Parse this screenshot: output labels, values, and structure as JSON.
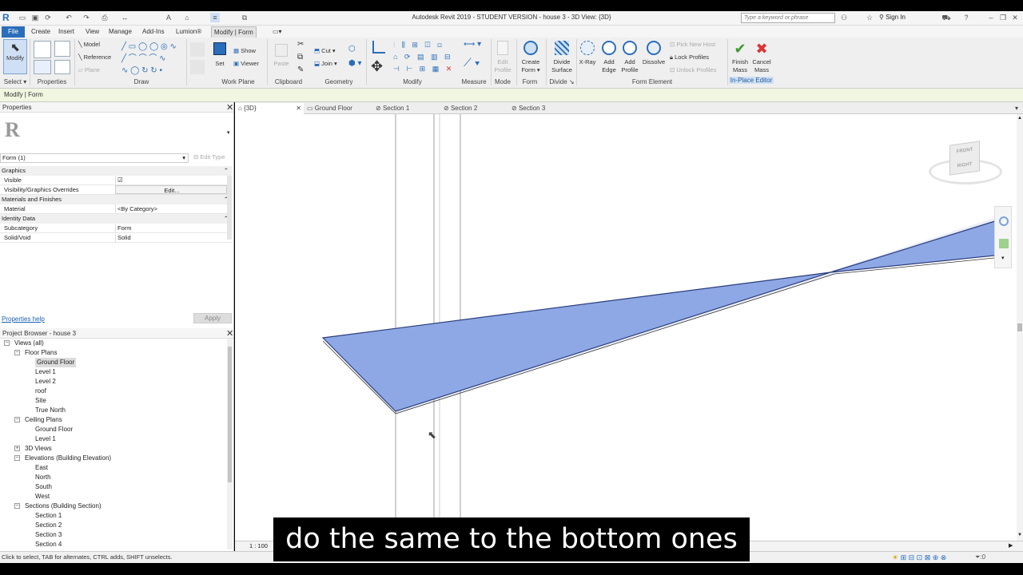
{
  "window": {
    "title": "Autodesk Revit 2019 - STUDENT VERSION - house 3 - 3D View: {3D}",
    "search_placeholder": "Type a keyword or phrase",
    "sign_in": "Sign In"
  },
  "ribbon_tabs": [
    "File",
    "Create",
    "Insert",
    "View",
    "Manage",
    "Add-Ins",
    "Lumion®",
    "Modify | Form"
  ],
  "ribbon": {
    "select": {
      "modify": "Modify",
      "label": "Select ▾"
    },
    "properties_label": "Properties",
    "draw": {
      "model": "Model",
      "reference": "Reference",
      "plane": "Plane",
      "label": "Draw"
    },
    "work_plane": {
      "set": "Set",
      "show": "Show",
      "viewer": "Viewer",
      "label": "Work Plane"
    },
    "clipboard": {
      "paste": "Paste",
      "cut": "Cut",
      "join": "Join",
      "label": "Clipboard"
    },
    "geometry_label": "Geometry",
    "modify_label": "Modify",
    "measure_label": "Measure",
    "mode": {
      "edit_profile_1": "Edit",
      "edit_profile_2": "Profile",
      "label": "Mode"
    },
    "form": {
      "create_1": "Create",
      "create_2": "Form",
      "label": "Form"
    },
    "divide": {
      "surface_1": "Divide",
      "surface_2": "Surface",
      "label": "Divide"
    },
    "form_element": {
      "xray": "X-Ray",
      "add_edge_1": "Add",
      "add_edge_2": "Edge",
      "add_profile_1": "Add",
      "add_profile_2": "Profile",
      "dissolve": "Dissolve",
      "pick_new_host": "Pick New Host",
      "lock_profiles": "Lock Profiles",
      "unlock_profiles": "Unlock Profiles",
      "label": "Form Element"
    },
    "in_place": {
      "finish_1": "Finish",
      "finish_2": "Mass",
      "cancel_1": "Cancel",
      "cancel_2": "Mass",
      "label": "In-Place Editor"
    }
  },
  "context_bar": "Modify | Form",
  "properties": {
    "header": "Properties",
    "type_selector": "Form (1)",
    "edit_type": "Edit Type",
    "groups": [
      {
        "name": "Graphics",
        "rows": [
          {
            "key": "Visible",
            "value": "☑"
          },
          {
            "key": "Visibility/Graphics Overrides",
            "value": "Edit..."
          }
        ]
      },
      {
        "name": "Materials and Finishes",
        "rows": [
          {
            "key": "Material",
            "value": "<By Category>"
          }
        ]
      },
      {
        "name": "Identity Data",
        "rows": [
          {
            "key": "Subcategory",
            "value": "Form"
          },
          {
            "key": "Solid/Void",
            "value": "Solid"
          }
        ]
      }
    ],
    "help_link": "Properties help",
    "apply": "Apply"
  },
  "project_browser": {
    "header": "Project Browser - house 3",
    "items": [
      {
        "label": "Views (all)",
        "level": 0,
        "twisty": "−"
      },
      {
        "label": "Floor Plans",
        "level": 1,
        "twisty": "−"
      },
      {
        "label": "Ground Floor",
        "level": 2,
        "selected": true
      },
      {
        "label": "Level 1",
        "level": 2
      },
      {
        "label": "Level 2",
        "level": 2
      },
      {
        "label": "roof",
        "level": 2
      },
      {
        "label": "Site",
        "level": 2
      },
      {
        "label": "True North",
        "level": 2
      },
      {
        "label": "Ceiling Plans",
        "level": 1,
        "twisty": "−"
      },
      {
        "label": "Ground Floor",
        "level": 2
      },
      {
        "label": "Level 1",
        "level": 2
      },
      {
        "label": "3D Views",
        "level": 1,
        "twisty": "+"
      },
      {
        "label": "Elevations (Building Elevation)",
        "level": 1,
        "twisty": "−"
      },
      {
        "label": "East",
        "level": 2
      },
      {
        "label": "North",
        "level": 2
      },
      {
        "label": "South",
        "level": 2
      },
      {
        "label": "West",
        "level": 2
      },
      {
        "label": "Sections (Building Section)",
        "level": 1,
        "twisty": "−"
      },
      {
        "label": "Section 1",
        "level": 2
      },
      {
        "label": "Section 2",
        "level": 2
      },
      {
        "label": "Section 3",
        "level": 2
      },
      {
        "label": "Section 4",
        "level": 2
      }
    ]
  },
  "view_tabs": [
    "{3D}",
    "Ground Floor",
    "Section 1",
    "Section 2",
    "Section 3"
  ],
  "view_scale": "1 : 100",
  "viewcube": {
    "front": "FRONT",
    "right": "RIGHT"
  },
  "status_text": "Click to select, TAB for alternates, CTRL adds, SHIFT unselects.",
  "status_filter": ":0",
  "subtitle": "do the same to the bottom ones",
  "colors": {
    "form_fill": "#8ea8e6",
    "accent": "#2a6ebb",
    "ctx_bar": "#f0f6e0"
  }
}
